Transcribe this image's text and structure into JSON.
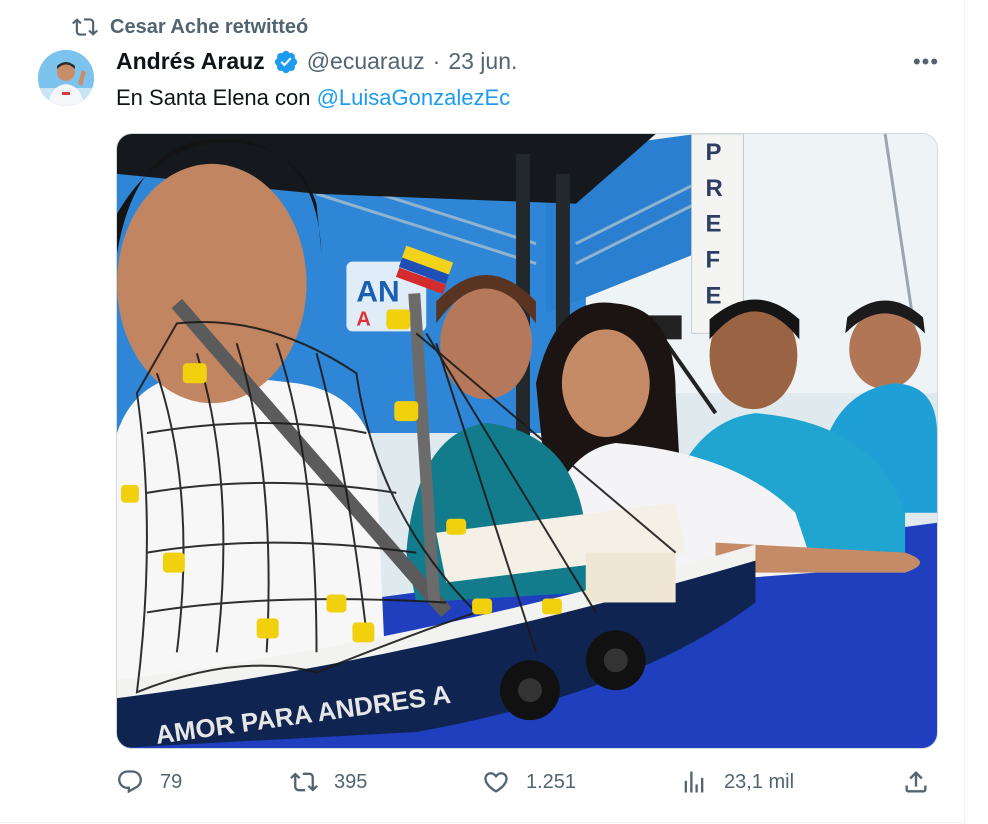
{
  "retweet": {
    "icon": "retweet-icon",
    "text": "Cesar Ache retwitteó"
  },
  "author": {
    "name": "Andrés Arauz",
    "verified_icon": "verified-badge-icon",
    "handle": "@ecuarauz",
    "separator": "·",
    "date": "23 jun."
  },
  "menu": {
    "icon": "more-icon",
    "label": "•••"
  },
  "tweet": {
    "text_prefix": "En Santa Elena con ",
    "mention": "@LuisaGonzalezEc"
  },
  "photo": {
    "sign_letters": [
      "P",
      "R",
      "E",
      "F",
      "E"
    ],
    "banner_text": "AN",
    "banner_text2": "A",
    "boat_text": "AMOR PARA ANDRES A"
  },
  "actions": {
    "reply": {
      "icon": "reply-icon",
      "count": "79"
    },
    "retweet": {
      "icon": "retweet-icon",
      "count": "395"
    },
    "like": {
      "icon": "heart-icon",
      "count": "1.251"
    },
    "views": {
      "icon": "views-icon",
      "count": "23,1 mil"
    },
    "share": {
      "icon": "share-icon"
    }
  },
  "colors": {
    "accent": "#1d9bf0",
    "secondary_text": "#536471",
    "primary_text": "#0f1419"
  }
}
